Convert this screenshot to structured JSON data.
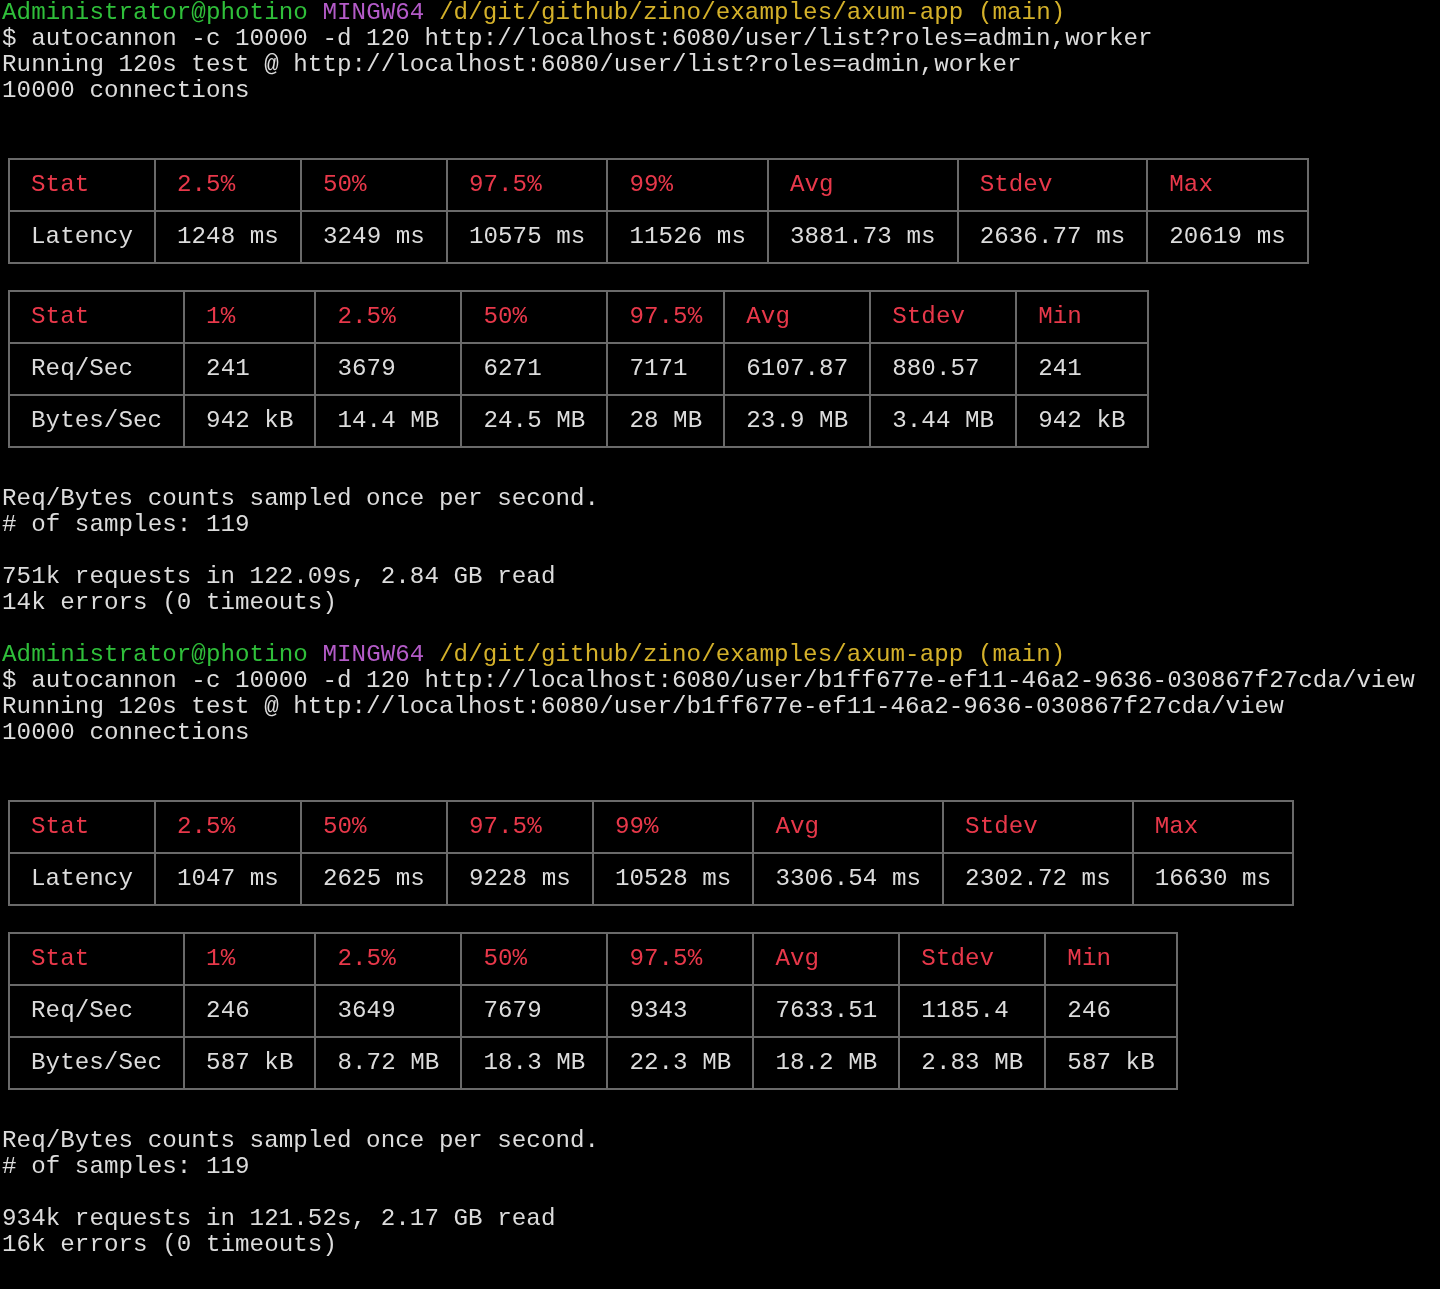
{
  "runs": [
    {
      "prompt": {
        "user_host": "Administrator@photino",
        "shell": "MINGW64",
        "path": "/d/git/github/zino/examples/axum-app",
        "branch": "(main)"
      },
      "command": "$ autocannon -c 10000 -d 120 http://localhost:6080/user/list?roles=admin,worker",
      "output": [
        "Running 120s test @ http://localhost:6080/user/list?roles=admin,worker",
        "10000 connections"
      ],
      "tables": [
        {
          "header": [
            "Stat",
            "2.5%",
            "50%",
            "97.5%",
            "99%",
            "Avg",
            "Stdev",
            "Max"
          ],
          "rows": [
            [
              "Latency",
              "1248 ms",
              "3249 ms",
              "10575 ms",
              "11526 ms",
              "3881.73 ms",
              "2636.77 ms",
              "20619 ms"
            ]
          ]
        },
        {
          "header": [
            "Stat",
            "1%",
            "2.5%",
            "50%",
            "97.5%",
            "Avg",
            "Stdev",
            "Min"
          ],
          "rows": [
            [
              "Req/Sec",
              "241",
              "3679",
              "6271",
              "7171",
              "6107.87",
              "880.57",
              "241"
            ],
            [
              "Bytes/Sec",
              "942 kB",
              "14.4 MB",
              "24.5 MB",
              "28 MB",
              "23.9 MB",
              "3.44 MB",
              "942 kB"
            ]
          ]
        }
      ],
      "notes": [
        "Req/Bytes counts sampled once per second.",
        "# of samples: 119"
      ],
      "summary": [
        "751k requests in 122.09s, 2.84 GB read",
        "14k errors (0 timeouts)"
      ]
    },
    {
      "prompt": {
        "user_host": "Administrator@photino",
        "shell": "MINGW64",
        "path": "/d/git/github/zino/examples/axum-app",
        "branch": "(main)"
      },
      "command": "$ autocannon -c 10000 -d 120 http://localhost:6080/user/b1ff677e-ef11-46a2-9636-030867f27cda/view",
      "output": [
        "Running 120s test @ http://localhost:6080/user/b1ff677e-ef11-46a2-9636-030867f27cda/view",
        "10000 connections"
      ],
      "tables": [
        {
          "header": [
            "Stat",
            "2.5%",
            "50%",
            "97.5%",
            "99%",
            "Avg",
            "Stdev",
            "Max"
          ],
          "rows": [
            [
              "Latency",
              "1047 ms",
              "2625 ms",
              "9228 ms",
              "10528 ms",
              "3306.54 ms",
              "2302.72 ms",
              "16630 ms"
            ]
          ]
        },
        {
          "header": [
            "Stat",
            "1%",
            "2.5%",
            "50%",
            "97.5%",
            "Avg",
            "Stdev",
            "Min"
          ],
          "rows": [
            [
              "Req/Sec",
              "246",
              "3649",
              "7679",
              "9343",
              "7633.51",
              "1185.4",
              "246"
            ],
            [
              "Bytes/Sec",
              "587 kB",
              "8.72 MB",
              "18.3 MB",
              "22.3 MB",
              "18.2 MB",
              "2.83 MB",
              "587 kB"
            ]
          ]
        }
      ],
      "notes": [
        "Req/Bytes counts sampled once per second.",
        "# of samples: 119"
      ],
      "summary": [
        "934k requests in 121.52s, 2.17 GB read",
        "16k errors (0 timeouts)"
      ]
    }
  ]
}
